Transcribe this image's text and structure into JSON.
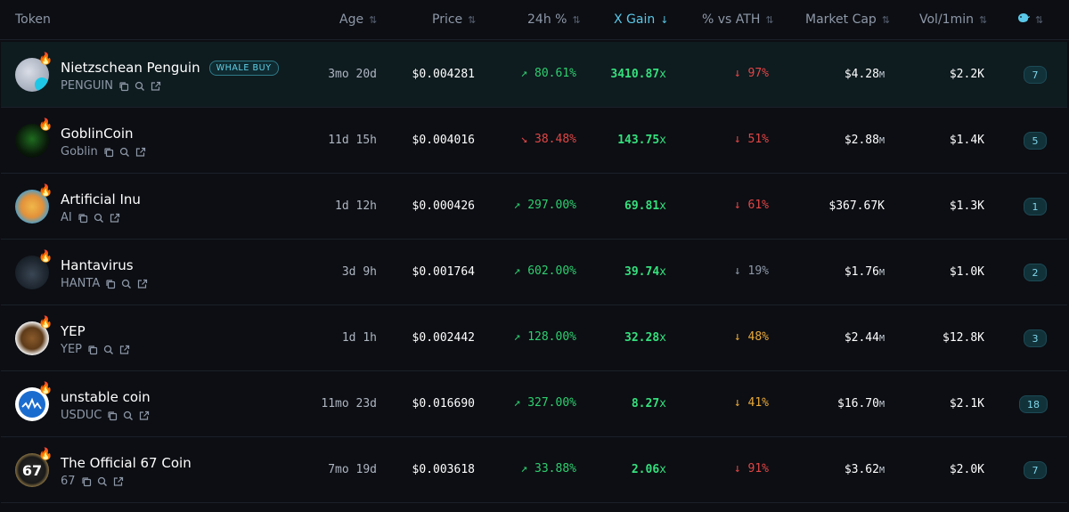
{
  "columns": {
    "token": "Token",
    "age": "Age",
    "price": "Price",
    "change24h": "24h %",
    "xgain": "X Gain",
    "vs_ath": "% vs ATH",
    "market_cap": "Market Cap",
    "vol": "Vol/1min",
    "whale_icon": "whale-icon"
  },
  "colors": {
    "up": "#2fcf6f",
    "down": "#e24646",
    "warn": "#e9a93a",
    "accent": "#5ac8e8"
  },
  "rows": [
    {
      "name": "Nietzschean Penguin",
      "symbol": "PENGUIN",
      "badge": "WHALE BUY",
      "age": "3mo 20d",
      "price": "$0.004281",
      "change": "80.61%",
      "change_dir": "up",
      "xgain": "3410.87",
      "xsuffix": "x",
      "ath": "97%",
      "ath_dir": "down",
      "mcap": "$4.28",
      "mcap_suffix": "M",
      "vol": "$2.2K",
      "count": "7"
    },
    {
      "name": "GoblinCoin",
      "symbol": "Goblin",
      "badge": "",
      "age": "11d 15h",
      "price": "$0.004016",
      "change": "38.48%",
      "change_dir": "down",
      "xgain": "143.75",
      "xsuffix": "x",
      "ath": "51%",
      "ath_dir": "down",
      "mcap": "$2.88",
      "mcap_suffix": "M",
      "vol": "$1.4K",
      "count": "5"
    },
    {
      "name": "Artificial Inu",
      "symbol": "AI",
      "badge": "",
      "age": "1d 12h",
      "price": "$0.000426",
      "change": "297.00%",
      "change_dir": "up",
      "xgain": "69.81",
      "xsuffix": "x",
      "ath": "61%",
      "ath_dir": "down",
      "mcap": "$367.67K",
      "mcap_suffix": "",
      "vol": "$1.3K",
      "count": "1"
    },
    {
      "name": "Hantavirus",
      "symbol": "HANTA",
      "badge": "",
      "age": "3d 9h",
      "price": "$0.001764",
      "change": "602.00%",
      "change_dir": "up",
      "xgain": "39.74",
      "xsuffix": "x",
      "ath": "19%",
      "ath_dir": "neutral",
      "mcap": "$1.76",
      "mcap_suffix": "M",
      "vol": "$1.0K",
      "count": "2"
    },
    {
      "name": "YEP",
      "symbol": "YEP",
      "badge": "",
      "age": "1d 1h",
      "price": "$0.002442",
      "change": "128.00%",
      "change_dir": "up",
      "xgain": "32.28",
      "xsuffix": "x",
      "ath": "48%",
      "ath_dir": "warn",
      "mcap": "$2.44",
      "mcap_suffix": "M",
      "vol": "$12.8K",
      "count": "3"
    },
    {
      "name": "unstable coin",
      "symbol": "USDUC",
      "badge": "",
      "age": "11mo 23d",
      "price": "$0.016690",
      "change": "327.00%",
      "change_dir": "up",
      "xgain": "8.27",
      "xsuffix": "x",
      "ath": "41%",
      "ath_dir": "warn",
      "mcap": "$16.70",
      "mcap_suffix": "M",
      "vol": "$2.1K",
      "count": "18"
    },
    {
      "name": "The Official 67 Coin",
      "symbol": "67",
      "badge": "",
      "age": "7mo 19d",
      "price": "$0.003618",
      "change": "33.88%",
      "change_dir": "up",
      "xgain": "2.06",
      "xsuffix": "x",
      "ath": "91%",
      "ath_dir": "down",
      "mcap": "$3.62",
      "mcap_suffix": "M",
      "vol": "$2.0K",
      "count": "7"
    }
  ],
  "avatar_labels": {
    "r6": "67"
  }
}
